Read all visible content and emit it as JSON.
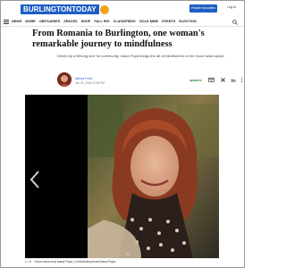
{
  "header": {
    "logo_text": "BURLINGTONTODAY",
    "reader_favorites_label": "Reader favourites",
    "login_label": "Log in"
  },
  "nav": {
    "items": [
      "NEWS",
      "MORE",
      "OBITUARIES",
      "SPACES",
      "SHOP",
      "FALL RIG",
      "CLASSIFIEDS",
      "GOLD MINE",
      "EVENTS",
      "ELECTION"
    ]
  },
  "article": {
    "title": "From Romania to Burlington, one woman's remarkable journey to mindfulness",
    "dek": "Driven by a lifelong love for community, Ioana Popa brings the art of mindfulness to the Good news space",
    "author": "Alexa Ford",
    "date": "Jun 22, 2026 12:30 PM",
    "sponsor_label": "spaces"
  },
  "gallery": {
    "counter": "1 / 4",
    "caption": "Good news host Ioana Popa | Contributed photo/Ioana Popa"
  },
  "colors": {
    "brand_blue": "#1d5ec3",
    "logo_badge": "#f2a31a",
    "gallery_bg": "#000000"
  }
}
